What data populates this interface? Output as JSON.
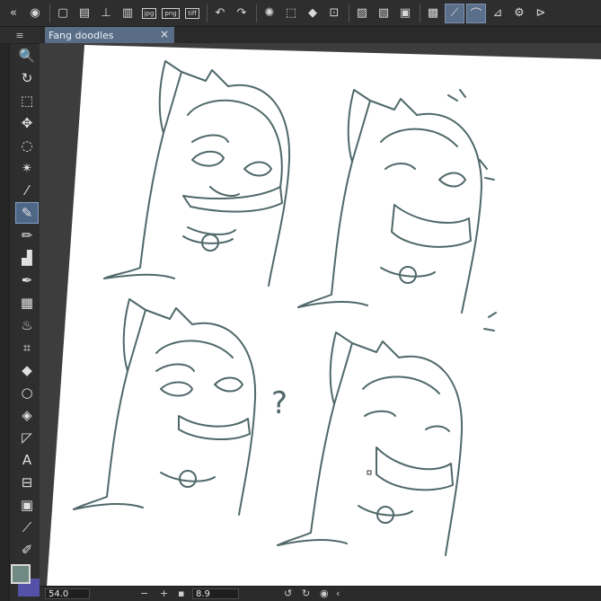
{
  "toolbar": {
    "left_icons": [
      "expand-icon",
      "clip-icon"
    ],
    "groups": [
      [
        "new-canvas-icon",
        "open-file-icon",
        "save-icon",
        "save-as-icon",
        "export-jpg-icon",
        "export-png-icon",
        "export-tiff-icon"
      ],
      [
        "undo-icon",
        "redo-icon"
      ],
      [
        "loading-icon",
        "clear-icon",
        "fill-icon",
        "transform-icon"
      ],
      [
        "grid-off-icon",
        "ruler-off-icon",
        "frame-icon"
      ],
      [
        "tone-icon",
        "line-correct-icon",
        "line-smooth-icon",
        "pressure-icon",
        "settings-icon",
        "animation-icon"
      ]
    ],
    "export_labels": {
      "jpg": "jpg",
      "png": "png",
      "tiff": "tiff"
    }
  },
  "document": {
    "tab_title": "Fang doodles",
    "close_glyph": "×"
  },
  "tools": [
    {
      "name": "zoom-tool",
      "glyph": "🔍"
    },
    {
      "name": "rotate-tool",
      "glyph": "↻"
    },
    {
      "name": "object-tool",
      "glyph": "⬚"
    },
    {
      "name": "move-tool",
      "glyph": "✥"
    },
    {
      "name": "lasso-tool",
      "glyph": "◌"
    },
    {
      "name": "auto-select-tool",
      "glyph": "✴"
    },
    {
      "name": "eyedropper-tool",
      "glyph": "⁄"
    },
    {
      "name": "pen-tool",
      "glyph": "✎",
      "active": true
    },
    {
      "name": "pencil-tool",
      "glyph": "✏"
    },
    {
      "name": "airbrush-tool",
      "glyph": "▟"
    },
    {
      "name": "decoration-tool",
      "glyph": "✒"
    },
    {
      "name": "tone-tool",
      "glyph": "▦"
    },
    {
      "name": "blend-tool",
      "glyph": "♨"
    },
    {
      "name": "grid-tool",
      "glyph": "⌗"
    },
    {
      "name": "fill-tool",
      "glyph": "◆"
    },
    {
      "name": "shape-tool",
      "glyph": "○"
    },
    {
      "name": "eraser-tool",
      "glyph": "◈"
    },
    {
      "name": "frame-border-tool",
      "glyph": "◸"
    },
    {
      "name": "text-tool",
      "glyph": "A"
    },
    {
      "name": "balloon-tool",
      "glyph": "⊟"
    },
    {
      "name": "gradient-tool",
      "glyph": "▣"
    },
    {
      "name": "ruler-tool",
      "glyph": "⟋"
    },
    {
      "name": "correct-line-tool",
      "glyph": "✐"
    }
  ],
  "colors": {
    "main": "#6f8a83",
    "sub": "#5452a8",
    "line": "#50686a",
    "accent": "#596d86"
  },
  "status": {
    "zoom": "54.0",
    "minus": "−",
    "plus": "+",
    "angle": "8.9"
  },
  "canvas_marks": {
    "question_mark": "?"
  }
}
